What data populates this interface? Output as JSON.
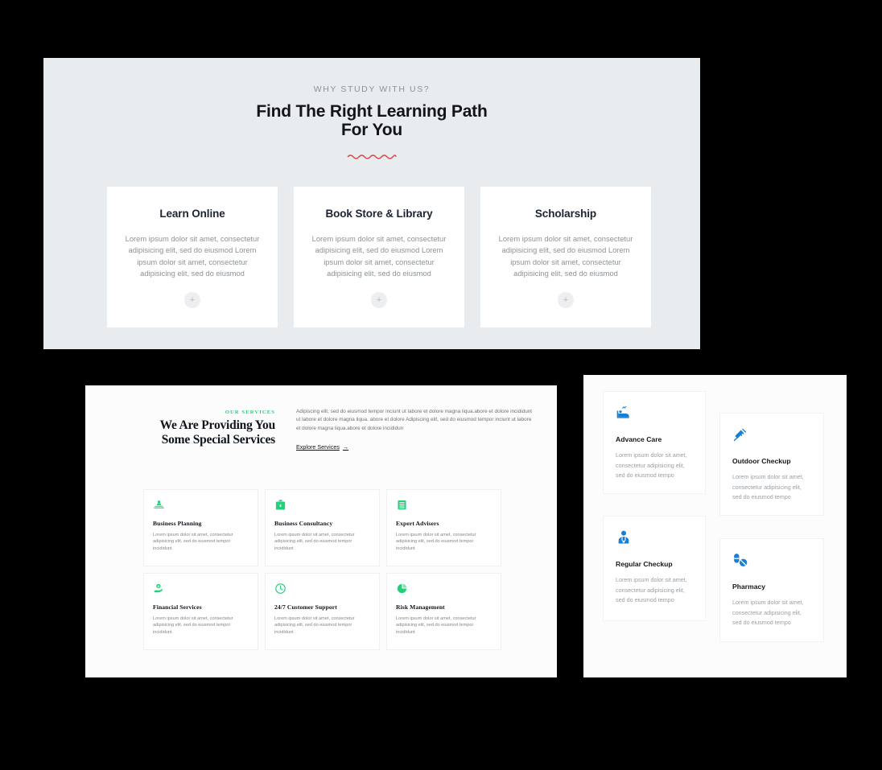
{
  "learning": {
    "eyebrow": "WHY STUDY WITH US?",
    "headline_line1": "Find The Right Learning Path",
    "headline_line2": "For You",
    "divider_icon": "wavy-line-divider",
    "divider_color": "#e0484a",
    "cards": [
      {
        "title": "Learn Online",
        "text": "Lorem ipsum dolor sit amet, consectetur adipisicing elit, sed do eiusmod Lorem ipsum dolor sit amet, consectetur adipisicing elit, sed do eiusmod",
        "action": "+"
      },
      {
        "title": "Book Store & Library",
        "text": "Lorem ipsum dolor sit amet, consectetur adipisicing elit, sed do eiusmod Lorem ipsum dolor sit amet, consectetur adipisicing elit, sed do eiusmod",
        "action": "+"
      },
      {
        "title": "Scholarship",
        "text": "Lorem ipsum dolor sit amet, consectetur adipisicing elit, sed do eiusmod Lorem ipsum dolor sit amet, consectetur adipisicing elit, sed do eiusmod",
        "action": "+"
      }
    ]
  },
  "services": {
    "eyebrow": "OUR SERVICES",
    "title_line1": "We Are Providing You",
    "title_line2": "Some Special Services",
    "accent_color": "#22d07a",
    "description": "Adipiscing elit, sed do eiusmod tempor inciunt ut labore et dolore magna liqua.abore et dolore incididunt ut labore et dolore magna liqua. abore et dolore Adipiscing elit, sed do eiusmod tempor inciunt ut labore et dolore magna liqua.abore et dolore incididun",
    "link_label": "Explore Services",
    "link_arrow": "→",
    "cards": [
      {
        "icon": "presentation-person-icon",
        "title": "Business Planning",
        "text": "Lorem ipsum dolor sit amet, consectetur adipisicing elit, sed do eiusmod tempor incididunt"
      },
      {
        "icon": "briefcase-icon",
        "title": "Business Consultancy",
        "text": "Lorem ipsum dolor sit amet, consectetur adipisicing elit, sed do eiusmod tempor incididunt"
      },
      {
        "icon": "document-lines-icon",
        "title": "Expert Advisers",
        "text": "Lorem ipsum dolor sit amet, consectetur adipisicing elit, sed do eiusmod tempor incididunt"
      },
      {
        "icon": "hand-money-icon",
        "title": "Financial Services",
        "text": "Lorem ipsum dolor sit amet, consectetur adipisicing elit, sed do eiusmod tempor incididunt"
      },
      {
        "icon": "clock-icon",
        "title": "24/7 Customer Support",
        "text": "Lorem ipsum dolor sit amet, consectetur adipisicing elit, sed do eiusmod tempor incididunt"
      },
      {
        "icon": "pie-chart-icon",
        "title": "Risk Management",
        "text": "Lorem ipsum dolor sit amet, consectetur adipisicing elit, sed do eiusmod tempor incididunt"
      }
    ]
  },
  "health": {
    "accent_color": "#1a7fd4",
    "cards": [
      {
        "icon": "hospital-bed-icon",
        "title": "Advance Care",
        "text": "Lorem ipsum dolor sit amet, consectetur adipisicing elit, sed do eiusmod tempo"
      },
      {
        "icon": "syringe-icon",
        "title": "Outdoor Checkup",
        "text": "Lorem ipsum dolor sit amet, consectetur adipisicing elit, sed do eiusmod tempo"
      },
      {
        "icon": "doctor-icon",
        "title": "Regular Checkup",
        "text": "Lorem ipsum dolor sit amet, consectetur adipisicing elit, sed do eiusmod tempo"
      },
      {
        "icon": "pills-icon",
        "title": "Pharmacy",
        "text": "Lorem ipsum dolor sit amet, consectetur adipisicing elit, sed do eiusmod tempo"
      }
    ]
  }
}
